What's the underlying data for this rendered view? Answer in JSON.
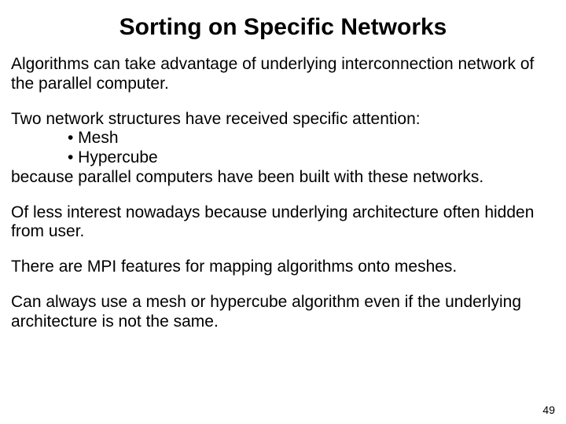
{
  "title": "Sorting on Specific Networks",
  "p1": "Algorithms can take advantage of underlying interconnection network of the parallel computer.",
  "b_intro": "Two network structures have received specific attention:",
  "b1": "• Mesh",
  "b2": "• Hypercube",
  "b_outro": "because parallel computers have been built with these networks.",
  "p3": "Of less interest nowadays because underlying architecture often hidden from user.",
  "p4": "There are MPI features for mapping algorithms onto meshes.",
  "p5": "Can always use a mesh or hypercube algorithm even if the underlying architecture is not the same.",
  "page": "49"
}
